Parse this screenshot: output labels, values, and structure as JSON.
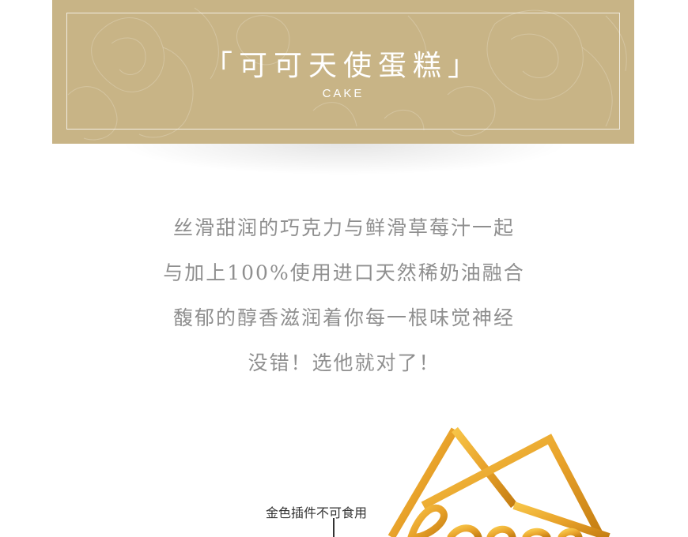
{
  "banner": {
    "title": "「可可天使蛋糕」",
    "subtitle": "CAKE"
  },
  "description": {
    "lines": [
      "丝滑甜润的巧克力与鲜滑草莓汁一起",
      "与加上100%使用进口天然稀奶油融合",
      "馥郁的醇香滋润着你每一根味觉神经",
      "没错！选他就对了！"
    ]
  },
  "product_image": {
    "plugin_label": "金色插件不可食用"
  },
  "colors": {
    "banner_bg": "#c8b486",
    "text_gray": "#8f8f8f",
    "gold": "#e8a72a"
  }
}
